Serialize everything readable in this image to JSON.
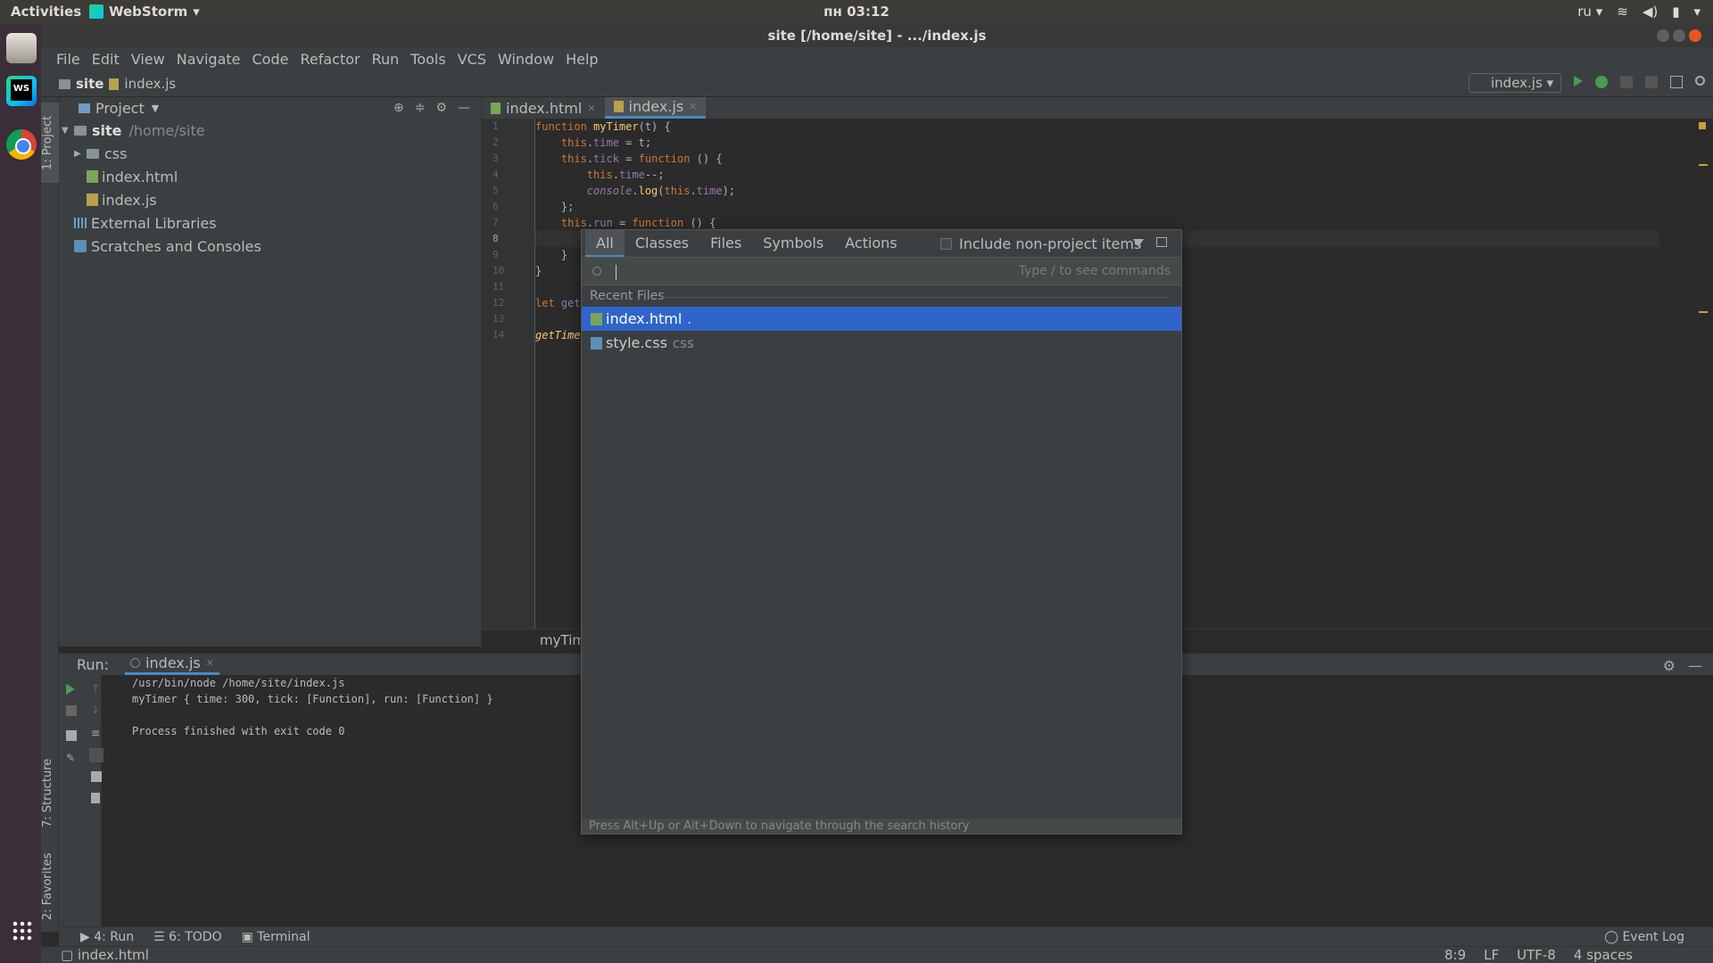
{
  "topbar": {
    "activities": "Activities",
    "app_name": "WebStorm",
    "clock": "пн 03:12",
    "lang": "ru"
  },
  "window": {
    "title": "site [/home/site] - .../index.js"
  },
  "menu": [
    "File",
    "Edit",
    "View",
    "Navigate",
    "Code",
    "Refactor",
    "Run",
    "Tools",
    "VCS",
    "Window",
    "Help"
  ],
  "navbar": {
    "project": "site",
    "file": "index.js",
    "run_config": "index.js"
  },
  "sidebar_tabs": {
    "project": "1: Project",
    "structure": "7: Structure",
    "favorites": "2: Favorites"
  },
  "project_panel": {
    "title": "Project",
    "tree": [
      {
        "label": "site",
        "hint": "/home/site"
      },
      {
        "label": "css"
      },
      {
        "label": "index.html"
      },
      {
        "label": "index.js"
      },
      {
        "label": "External Libraries"
      },
      {
        "label": "Scratches and Consoles"
      }
    ]
  },
  "editor": {
    "tabs": [
      {
        "label": "index.html"
      },
      {
        "label": "index.js"
      }
    ],
    "line_numbers": [
      "1",
      "2",
      "3",
      "4",
      "5",
      "6",
      "7",
      "8",
      "9",
      "10",
      "11",
      "12",
      "13",
      "14"
    ],
    "breadcrumb": "myTim"
  },
  "search_popup": {
    "tabs": [
      "All",
      "Classes",
      "Files",
      "Symbols",
      "Actions"
    ],
    "active_tab": "All",
    "include_label": "Include non-project items",
    "input_value": "",
    "hint": "Type / to see commands",
    "section_label": "Recent Files",
    "items": [
      {
        "name": "index.html",
        "suffix": "."
      },
      {
        "name": "style.css",
        "suffix": "css"
      }
    ],
    "footer": "Press Alt+Up or Alt+Down to navigate through the search history"
  },
  "run_panel": {
    "label": "Run:",
    "tab": "index.js",
    "output": [
      "/usr/bin/node /home/site/index.js",
      "myTimer { time: 300, tick: [Function], run: [Function] }",
      "",
      "Process finished with exit code 0"
    ]
  },
  "bottom_tools": {
    "run": "4: Run",
    "todo": "6: TODO",
    "terminal": "Terminal",
    "event_log": "Event Log"
  },
  "status": {
    "file": "index.html",
    "position": "8:9",
    "line_sep": "LF",
    "encoding": "UTF-8",
    "indent": "4 spaces"
  },
  "colors": {
    "selection": "#2f65ca",
    "tab_underline": "#4a88c7",
    "keyword": "#cc7832",
    "function": "#ffc66d",
    "property": "#9876aa"
  }
}
